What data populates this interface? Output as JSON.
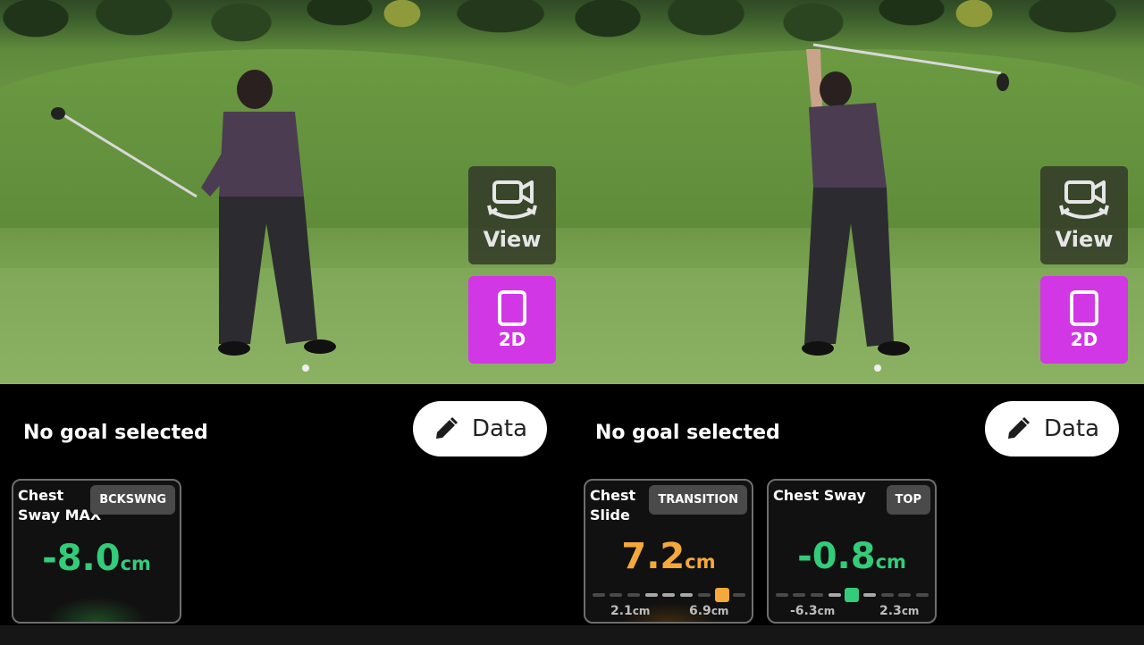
{
  "panels": [
    {
      "overlay": {
        "view_label": "View",
        "mode_label": "2D",
        "mode_color": "#d237e6"
      },
      "goal_text": "No goal selected",
      "data_button_label": "Data",
      "metrics": [
        {
          "title": "Chest Sway MAX",
          "tag": "BCKSWNG",
          "value": "-8.0",
          "unit": "cm",
          "color": "#33cc7a"
        }
      ]
    },
    {
      "overlay": {
        "view_label": "View",
        "mode_label": "2D",
        "mode_color": "#d237e6"
      },
      "goal_text": "No goal selected",
      "data_button_label": "Data",
      "metrics": [
        {
          "title": "Chest Slide",
          "tag": "TRANSITION",
          "value": "7.2",
          "unit": "cm",
          "color": "#f4a93a",
          "range_low": "2.1",
          "range_low_unit": "cm",
          "range_high": "6.9",
          "range_high_unit": "cm"
        },
        {
          "title": "Chest Sway",
          "tag": "TOP",
          "value": "-0.8",
          "unit": "cm",
          "color": "#33cc7a",
          "range_low": "-6.3",
          "range_low_unit": "cm",
          "range_high": "2.3",
          "range_high_unit": "cm"
        }
      ]
    }
  ],
  "icons": {
    "view": "camera-rotate-icon",
    "mode": "tablet-icon",
    "edit": "pencil-icon"
  }
}
